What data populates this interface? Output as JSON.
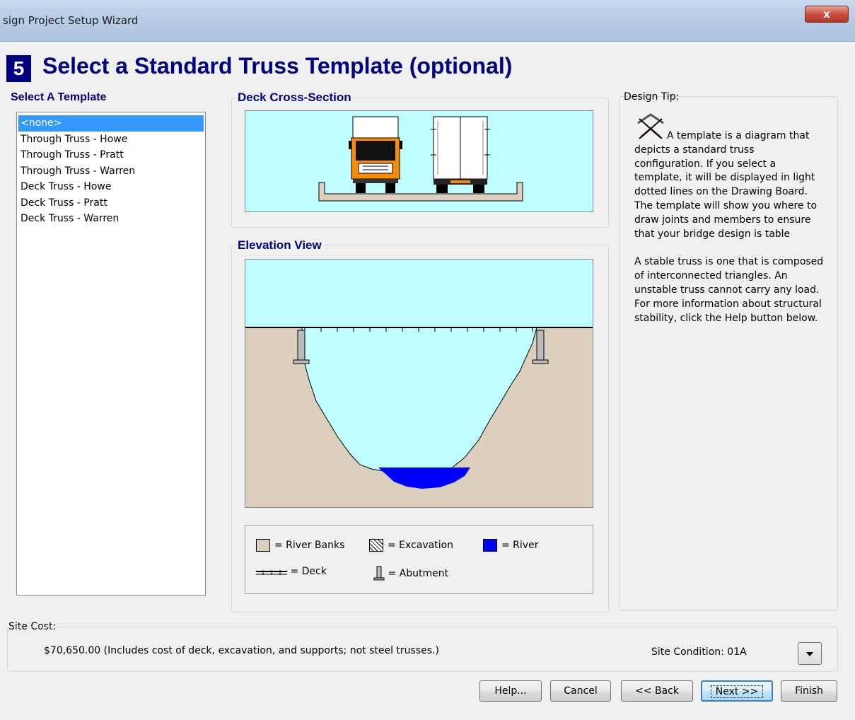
{
  "window": {
    "title": "sign Project Setup Wizard",
    "close_label": "x"
  },
  "step": {
    "number": "5",
    "title": "Select a Standard Truss Template (optional)"
  },
  "templates": {
    "label": "Select A Template",
    "items": [
      "<none>",
      "Through Truss - Howe",
      "Through Truss - Pratt",
      "Through Truss - Warren",
      "Deck Truss - Howe",
      "Deck Truss - Pratt",
      "Deck Truss - Warren"
    ],
    "selected_index": 0
  },
  "deck_section": {
    "label": "Deck Cross-Section"
  },
  "elevation": {
    "label": "Elevation View"
  },
  "legend": {
    "river_banks": "= River Banks",
    "excavation": "= Excavation",
    "river": "= River",
    "deck": "= Deck",
    "abutment": "= Abutment"
  },
  "design_tip": {
    "label": "Design Tip:",
    "paragraph1": "A template is a diagram that depicts a standard truss configuration. If you select a template, it will be displayed in light dotted lines on the Drawing Board. The template will show you where to draw joints and members to ensure that your bridge design is table",
    "paragraph2": "A stable truss is one that is composed of interconnected triangles. An unstable truss cannot carry any load. For more information about structural stability, click the Help button below."
  },
  "site_cost": {
    "label": "Site Cost:",
    "value": "$70,650.00",
    "note": "(Includes cost of deck, excavation, and supports; not steel trusses.)",
    "condition": "Site Condition: 01A"
  },
  "buttons": {
    "help": "Help...",
    "cancel": "Cancel",
    "back": "<< Back",
    "next": "Next >>",
    "finish": "Finish"
  },
  "colors": {
    "sky": "#c0ffff",
    "bank": "#dccfbd",
    "river": "#0000ff",
    "truck_orange": "#ff8c00",
    "heading": "#000080",
    "selected": "#3399ff"
  }
}
